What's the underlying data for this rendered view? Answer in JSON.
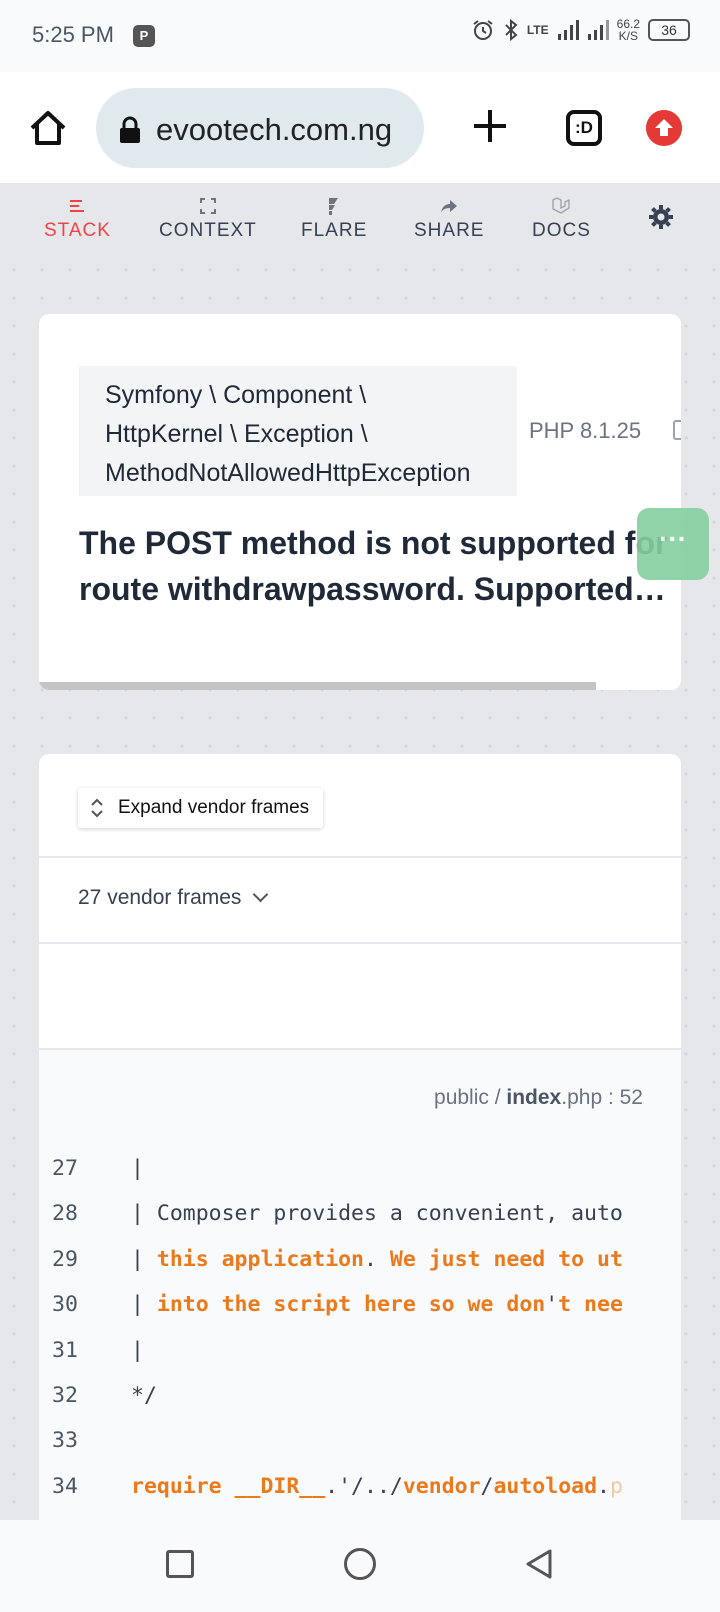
{
  "status_bar": {
    "time": "5:25 PM",
    "badge": "P",
    "lte": "LTE",
    "speed_value": "66.2",
    "speed_unit": "K/S",
    "battery": "36"
  },
  "browser": {
    "url": "evootech.com.ng",
    "tabs_label": ":D"
  },
  "tabs": [
    {
      "label": "STACK",
      "icon": "stack-icon",
      "active": true
    },
    {
      "label": "CONTEXT",
      "icon": "expand-icon"
    },
    {
      "label": "FLARE",
      "icon": "flare-icon"
    },
    {
      "label": "SHARE",
      "icon": "share-icon"
    },
    {
      "label": "DOCS",
      "icon": "laravel-icon"
    }
  ],
  "error": {
    "exception_lines": [
      "Symfony \\ Component \\",
      "HttpKernel \\ Exception \\",
      "MethodNotAllowedHttpException"
    ],
    "php_version": "PHP 8.1.25",
    "message_line1": "The POST method is not supported for",
    "message_line2": "route withdrawpassword. Supported…"
  },
  "fab_label": "···",
  "stack": {
    "expand_label": "Expand vendor frames",
    "vendor_frames": "27 vendor frames",
    "file_dir": "public / ",
    "file_name": "index",
    "file_ext": ".php",
    "file_line": " : 52",
    "code_lines": [
      {
        "n": "27",
        "html": "|"
      },
      {
        "n": "28",
        "html": "| Composer provides a convenient, auto"
      },
      {
        "n": "29",
        "html": "| <span class='o'>this application</span>. <span class='o'>We just need to ut</span>"
      },
      {
        "n": "30",
        "html": "| <span class='o'>into the script here so we don</span>'<span class='o'>t nee</span>"
      },
      {
        "n": "31",
        "html": "|"
      },
      {
        "n": "32",
        "html": "*/"
      },
      {
        "n": "33",
        "html": ""
      },
      {
        "n": "34",
        "html": "<span class='o'>require __DIR__</span>.'/../<span class='o'>vendor</span>/<span class='o'>autoload</span>.<span class='fade'>p</span>"
      }
    ]
  }
}
